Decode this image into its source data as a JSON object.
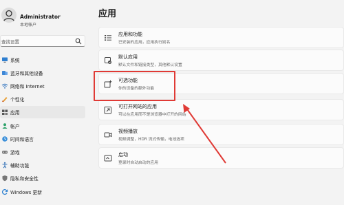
{
  "user": {
    "name": "Administrator",
    "account": "本地帐户"
  },
  "search": {
    "placeholder": "查找设置"
  },
  "sidebar": {
    "items": [
      {
        "label": "系统",
        "icon": "system-icon",
        "active": false
      },
      {
        "label": "蓝牙和其他设备",
        "icon": "bluetooth-icon",
        "active": false
      },
      {
        "label": "网络和 Internet",
        "icon": "network-icon",
        "active": false
      },
      {
        "label": "个性化",
        "icon": "personalization-icon",
        "active": false
      },
      {
        "label": "应用",
        "icon": "apps-icon",
        "active": true
      },
      {
        "label": "帐户",
        "icon": "accounts-icon",
        "active": false
      },
      {
        "label": "时间和语言",
        "icon": "time-language-icon",
        "active": false
      },
      {
        "label": "游戏",
        "icon": "gaming-icon",
        "active": false
      },
      {
        "label": "辅助功能",
        "icon": "accessibility-icon",
        "active": false
      },
      {
        "label": "隐私和安全性",
        "icon": "privacy-icon",
        "active": false
      },
      {
        "label": "Windows 更新",
        "icon": "windows-update-icon",
        "active": false
      }
    ]
  },
  "main": {
    "title": "应用",
    "cards": [
      {
        "title": "应用和功能",
        "desc": "已安装的应用，应用执行别名",
        "icon": "apps-features-icon"
      },
      {
        "title": "默认应用",
        "desc": "默认文件和链接类型，其他默认设置",
        "icon": "default-apps-icon"
      },
      {
        "title": "可选功能",
        "desc": "你的设备的额外功能",
        "icon": "optional-features-icon"
      },
      {
        "title": "可打开网站的应用",
        "desc": "可以在应用而不是浏览器中打开的网站",
        "icon": "apps-for-websites-icon"
      },
      {
        "title": "视频播放",
        "desc": "视频调整，HDR 流式传输，电池选项",
        "icon": "video-playback-icon"
      },
      {
        "title": "启动",
        "desc": "登录时自动启动的应用",
        "icon": "startup-icon"
      }
    ]
  },
  "colors": {
    "accent": "#0067c0",
    "annotation": "#e03a35"
  }
}
